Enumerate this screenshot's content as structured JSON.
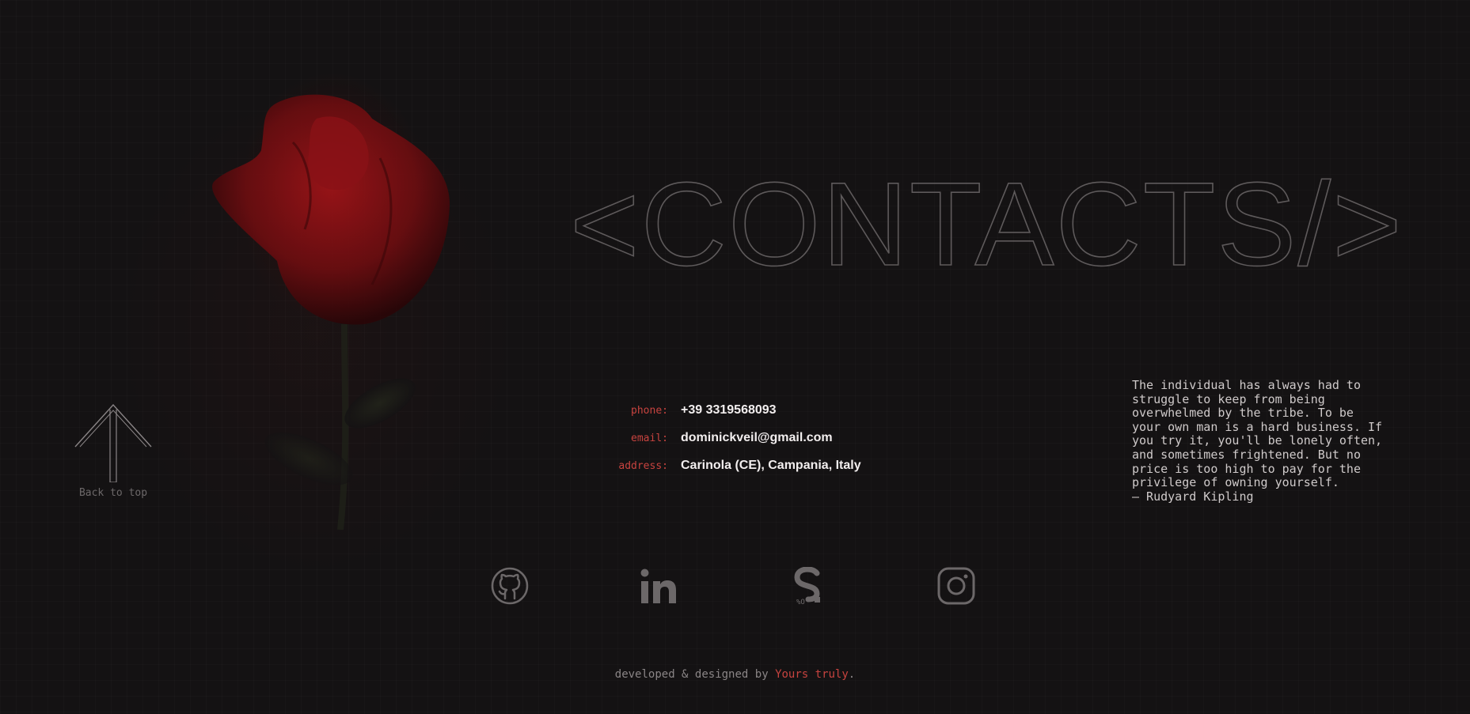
{
  "title": "<CONTACTS/>",
  "back_to_top": {
    "label": "Back to top",
    "icon": "arrow-up-icon"
  },
  "contacts": [
    {
      "key": "phone:",
      "value": "+39 3319568093"
    },
    {
      "key": "email:",
      "value": "dominickveil@gmail.com"
    },
    {
      "key": "address:",
      "value": "Carinola (CE), Campania, Italy"
    }
  ],
  "quote": {
    "text": "The individual has always had to\nstruggle to keep from being\noverwhelmed by the tribe. To be\nyour own man is a hard business. If\nyou try it, you'll be lonely often,\nand sometimes frightened. But no\nprice is too high to pay for the\nprivilege of owning yourself.",
    "author": "— Rudyard Kipling"
  },
  "socials": [
    {
      "icon": "github-icon"
    },
    {
      "icon": "linkedin-icon"
    },
    {
      "icon": "spotify-like-s-icon"
    },
    {
      "icon": "instagram-icon"
    }
  ],
  "footer": {
    "prefix": "developed & designed by ",
    "link": "Yours truly",
    "suffix": "."
  },
  "colors": {
    "background": "#141213",
    "accent": "#c7433f",
    "text": "#f2eeee",
    "muted": "#6c6869",
    "outline": "#5a5657"
  }
}
